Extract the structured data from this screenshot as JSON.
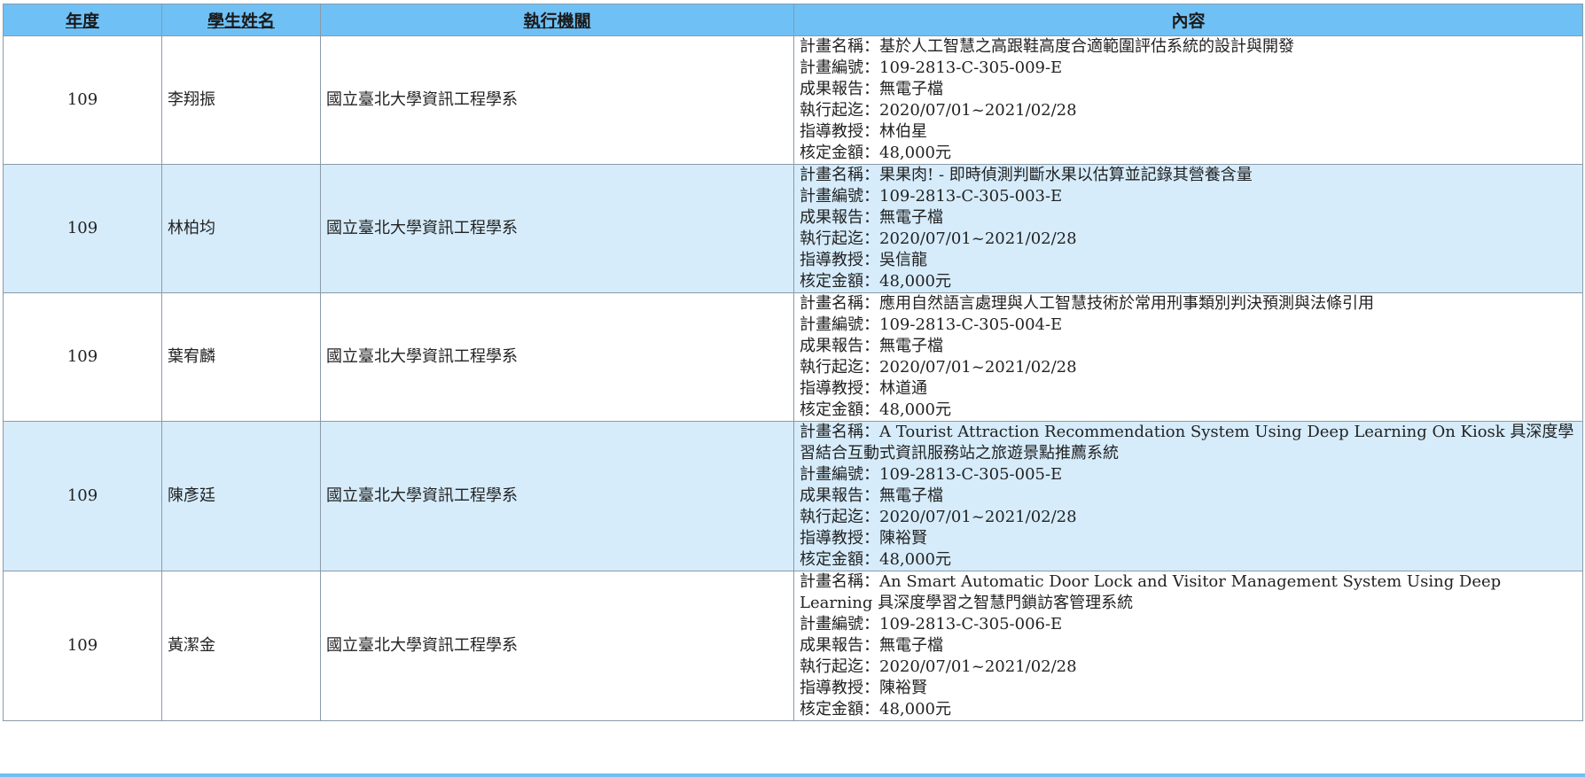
{
  "table": {
    "headers": {
      "year": "年度",
      "student": "學生姓名",
      "org": "執行機關",
      "content": "內容"
    },
    "rows": [
      {
        "year": "109",
        "student": "李翔振",
        "org": "國立臺北大學資訊工程學系",
        "content": [
          "計畫名稱：基於人工智慧之高跟鞋高度合適範圍評估系統的設計與開發",
          "計畫編號：109-2813-C-305-009-E",
          "成果報告：無電子檔",
          "執行起迄：2020/07/01~2021/02/28",
          "指導教授：林伯星",
          "核定金額：48,000元"
        ]
      },
      {
        "year": "109",
        "student": "林柏均",
        "org": "國立臺北大學資訊工程學系",
        "content": [
          "計畫名稱：果果肉! - 即時偵測判斷水果以估算並記錄其營養含量",
          "計畫編號：109-2813-C-305-003-E",
          "成果報告：無電子檔",
          "執行起迄：2020/07/01~2021/02/28",
          "指導教授：吳信龍",
          "核定金額：48,000元"
        ]
      },
      {
        "year": "109",
        "student": "葉宥麟",
        "org": "國立臺北大學資訊工程學系",
        "content": [
          "計畫名稱：應用自然語言處理與人工智慧技術於常用刑事類別判決預測與法條引用",
          "計畫編號：109-2813-C-305-004-E",
          "成果報告：無電子檔",
          "執行起迄：2020/07/01~2021/02/28",
          "指導教授：林道通",
          "核定金額：48,000元"
        ]
      },
      {
        "year": "109",
        "student": "陳彥廷",
        "org": "國立臺北大學資訊工程學系",
        "content": [
          "計畫名稱：A Tourist Attraction Recommendation System Using Deep Learning On Kiosk 具深度學習結合互動式資訊服務站之旅遊景點推薦系統",
          "計畫編號：109-2813-C-305-005-E",
          "成果報告：無電子檔",
          "執行起迄：2020/07/01~2021/02/28",
          "指導教授：陳裕賢",
          "核定金額：48,000元"
        ]
      },
      {
        "year": "109",
        "student": "黃潔金",
        "org": "國立臺北大學資訊工程學系",
        "content": [
          "計畫名稱：An Smart Automatic Door Lock and Visitor Management System Using Deep Learning 具深度學習之智慧門鎖訪客管理系統",
          "計畫編號：109-2813-C-305-006-E",
          "成果報告：無電子檔",
          "執行起迄：2020/07/01~2021/02/28",
          "指導教授：陳裕賢",
          "核定金額：48,000元"
        ]
      }
    ]
  },
  "colors": {
    "header_bg": "#6fc0f5",
    "row_alt_bg": "#d6ecfb",
    "border": "#8a9aa8"
  }
}
